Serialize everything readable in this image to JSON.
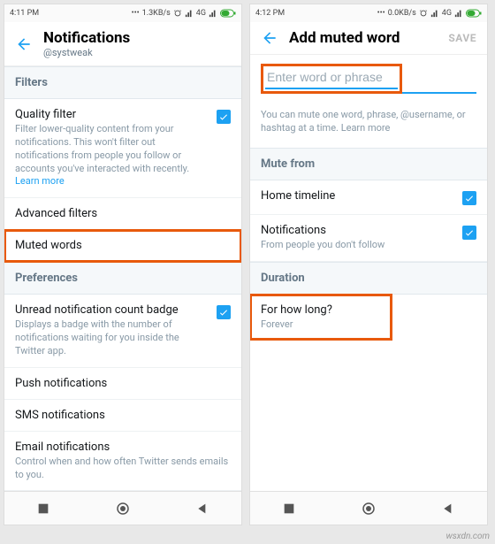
{
  "watermark": "wsxdn.com",
  "left": {
    "status": {
      "time": "4:11 PM",
      "speed": "1.3KB/s",
      "net": "4G"
    },
    "appbar": {
      "title": "Notifications",
      "subtitle": "@systweak"
    },
    "sections": {
      "filters": "Filters",
      "preferences": "Preferences"
    },
    "quality": {
      "label": "Quality filter",
      "desc": "Filter lower-quality content from your notifications. This won't filter out notifications from people you follow or accounts you've interacted with recently.",
      "learn": "Learn more"
    },
    "advanced": {
      "label": "Advanced filters"
    },
    "muted": {
      "label": "Muted words"
    },
    "unread": {
      "label": "Unread notification count badge",
      "desc": "Displays a badge with the number of notifications waiting for you inside the Twitter app."
    },
    "push": {
      "label": "Push notifications"
    },
    "sms": {
      "label": "SMS notifications"
    },
    "email": {
      "label": "Email notifications",
      "desc": "Control when and how often Twitter sends emails to you."
    }
  },
  "right": {
    "status": {
      "time": "4:12 PM",
      "speed": "0.0KB/s",
      "net": "4G"
    },
    "appbar": {
      "title": "Add muted word",
      "save": "SAVE"
    },
    "input": {
      "placeholder": "Enter word or phrase"
    },
    "helper": {
      "text": "You can mute one word, phrase, @username, or hashtag at a time.",
      "learn": "Learn more"
    },
    "sections": {
      "mutefrom": "Mute from",
      "duration": "Duration"
    },
    "home": {
      "label": "Home timeline"
    },
    "notifs": {
      "label": "Notifications",
      "desc": "From people you don't follow"
    },
    "howlong": {
      "label": "For how long?",
      "value": "Forever"
    }
  }
}
